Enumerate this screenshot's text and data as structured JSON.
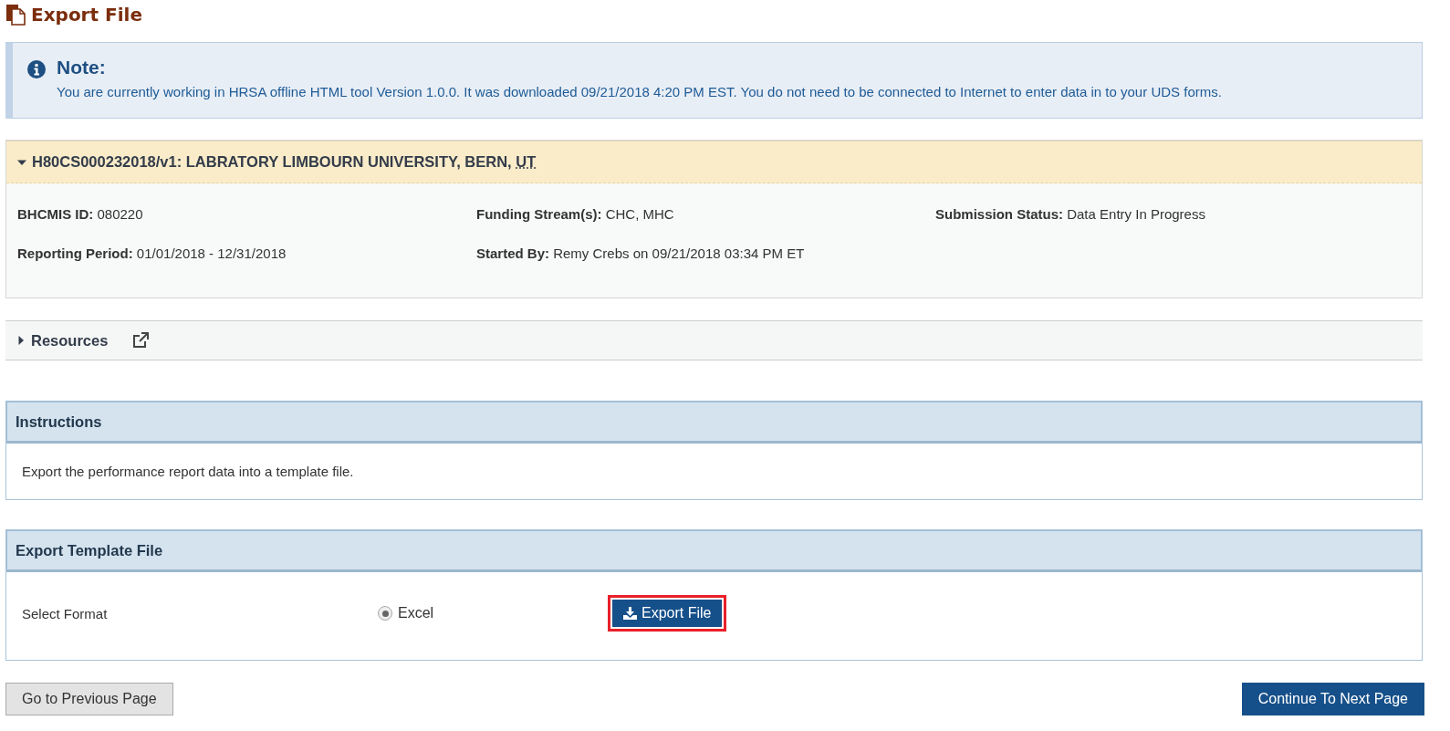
{
  "page_title": "Export File",
  "note": {
    "title": "Note:",
    "text": "You are currently working in HRSA offline HTML tool Version 1.0.0. It was downloaded 09/21/2018 4:20 PM EST. You do not need to be connected to Internet to enter data in to your UDS forms."
  },
  "grant": {
    "title": "H80CS000232018/v1: LABRATORY LIMBOURN UNIVERSITY, BERN, ",
    "state_abbr": "UT",
    "expanded": true,
    "fields": [
      {
        "label": "BHCMIS ID:",
        "value": "080220"
      },
      {
        "label": "Funding Stream(s):",
        "value": "CHC, MHC"
      },
      {
        "label": "Submission Status:",
        "value": "Data Entry In Progress"
      },
      {
        "label": "Reporting Period:",
        "value": "01/01/2018 - 12/31/2018"
      },
      {
        "label": "Started By:",
        "value": "Remy Crebs on 09/21/2018 03:34 PM ET"
      }
    ]
  },
  "resources": {
    "label": "Resources",
    "expanded": false
  },
  "instructions": {
    "title": "Instructions",
    "text": "Export the performance report data into a template file."
  },
  "export_panel": {
    "title": "Export Template File",
    "field_label": "Select Format",
    "formats": [
      {
        "label": "Excel",
        "selected": true
      }
    ],
    "export_button": {
      "label": "Export File",
      "highlighted": true
    }
  },
  "footer": {
    "previous": "Go to Previous Page",
    "next": "Continue To Next Page"
  }
}
